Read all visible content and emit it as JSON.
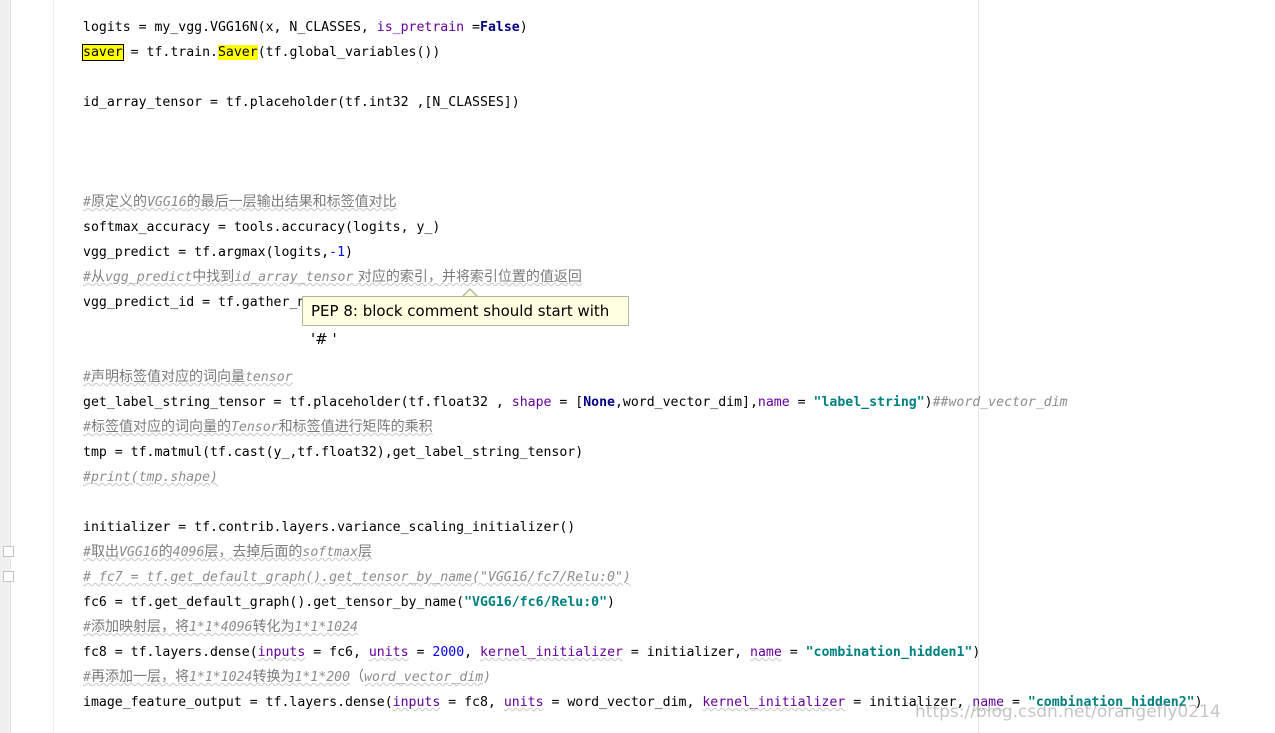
{
  "tooltip": {
    "text": "PEP 8: block comment should start with '# '"
  },
  "watermark": "https://blog.csdn.net/orangefly0214",
  "colors": {
    "keyword": "#000080",
    "number": "#0000ff",
    "string": "#008080",
    "param": "#660099",
    "comment": "#8c8c8c",
    "highlight": "#ffff00",
    "tooltip_bg": "#ffffe1"
  },
  "code": {
    "l1": {
      "a": "logits = my_vgg.VGG16N(x, N_CLASSES, ",
      "p1": "is_pretrain",
      "b": " =",
      "k1": "False",
      "c": ")"
    },
    "l2": {
      "v": "saver",
      "a": " = tf.train.",
      "s": "Saver",
      "b": "(tf.global_variables())"
    },
    "l3": {
      "a": "id_array_tensor = tf.placeholder(tf.int32 ,[N_CLASSES])"
    },
    "l4": {
      "h": "#",
      "c": "原定义的",
      "i": "VGG16",
      "d": "的最后一层输出结果和标签值对比"
    },
    "l5": {
      "a": "softmax_accuracy = tools.accuracy(logits, y_)"
    },
    "l6": {
      "a": "vgg_predict = tf.argmax(logits,",
      "n": "-1",
      "b": ")"
    },
    "l7": {
      "h": "#",
      "c": "从",
      "i1": "vgg_predict",
      "d": "中找到",
      "i2": "id_array_tensor",
      "e": " 对应的索引，并将索引位置的值返回"
    },
    "l8": {
      "a": "vgg_predict_id = tf.gather_n"
    },
    "l9": {
      "h": "#",
      "c": "声明标签值对应的词向量",
      "i": "tensor"
    },
    "l10": {
      "a": "get_label_string_tensor = tf.placeholder(tf.float32 , ",
      "p1": "shape",
      "b": " = [",
      "k1": "None",
      "c": ",word_vector_dim],",
      "p2": "name",
      "d": " = ",
      "s": "\"label_string\"",
      "e": ")",
      "cm": "##word_vector_dim"
    },
    "l11": {
      "h": "#",
      "c": "标签值对应的词向量的",
      "i": "Tensor",
      "d": "和标签值进行矩阵的乘积"
    },
    "l12": {
      "a": "tmp = tf.matmul(tf.cast(y_,tf.float32),get_label_string_tensor)"
    },
    "l13": {
      "a": "#print(tmp.shape)"
    },
    "l14": {
      "a": "initializer = tf.contrib.layers.variance_scaling_initializer()"
    },
    "l15": {
      "h": "#",
      "c": "取出",
      "i1": "VGG16",
      "d": "的",
      "i2": "4096",
      "e": "层，去掉后面的",
      "i3": "softmax",
      "f": "层"
    },
    "l16": {
      "a": "# fc7 = tf.get_default_graph().get_tensor_by_name(\"VGG16/fc7/Relu:0\")"
    },
    "l17": {
      "a": "fc6 = tf.get_default_graph().get_tensor_by_name(",
      "s": "\"VGG16/fc6/Relu:0\"",
      "b": ")"
    },
    "l18": {
      "h": "#",
      "c": "添加映射层，将",
      "i1": "1*1*4096",
      "d": "转化为",
      "i2": "1*1*1024"
    },
    "l19": {
      "a": "fc8 = tf.layers.dense(",
      "p1": "inputs",
      "b": " = fc6, ",
      "p2": "units",
      "c": " = ",
      "n": "2000",
      "d": ", ",
      "p3": "kernel_initializer",
      "e": " = initializer, ",
      "p4": "name",
      "f": " = ",
      "s": "\"combination_hidden1\"",
      "g": ")"
    },
    "l20": {
      "h": "#",
      "c": "再添加一层，将",
      "i1": "1*1*1024",
      "d": "转换为",
      "i2": "1*1*200",
      "e": "（",
      "i3": "word_vector_dim",
      "f": ")"
    },
    "l21": {
      "a": "image_feature_output = tf.layers.dense(",
      "p1": "inputs",
      "b": " = fc8, ",
      "p2": "units",
      "c": " = word_vector_dim, ",
      "p3": "kernel_initializer",
      "d": " = initializer, ",
      "p4": "name",
      "e": " = ",
      "s": "\"combination_hidden2\"",
      "f": ")"
    }
  }
}
